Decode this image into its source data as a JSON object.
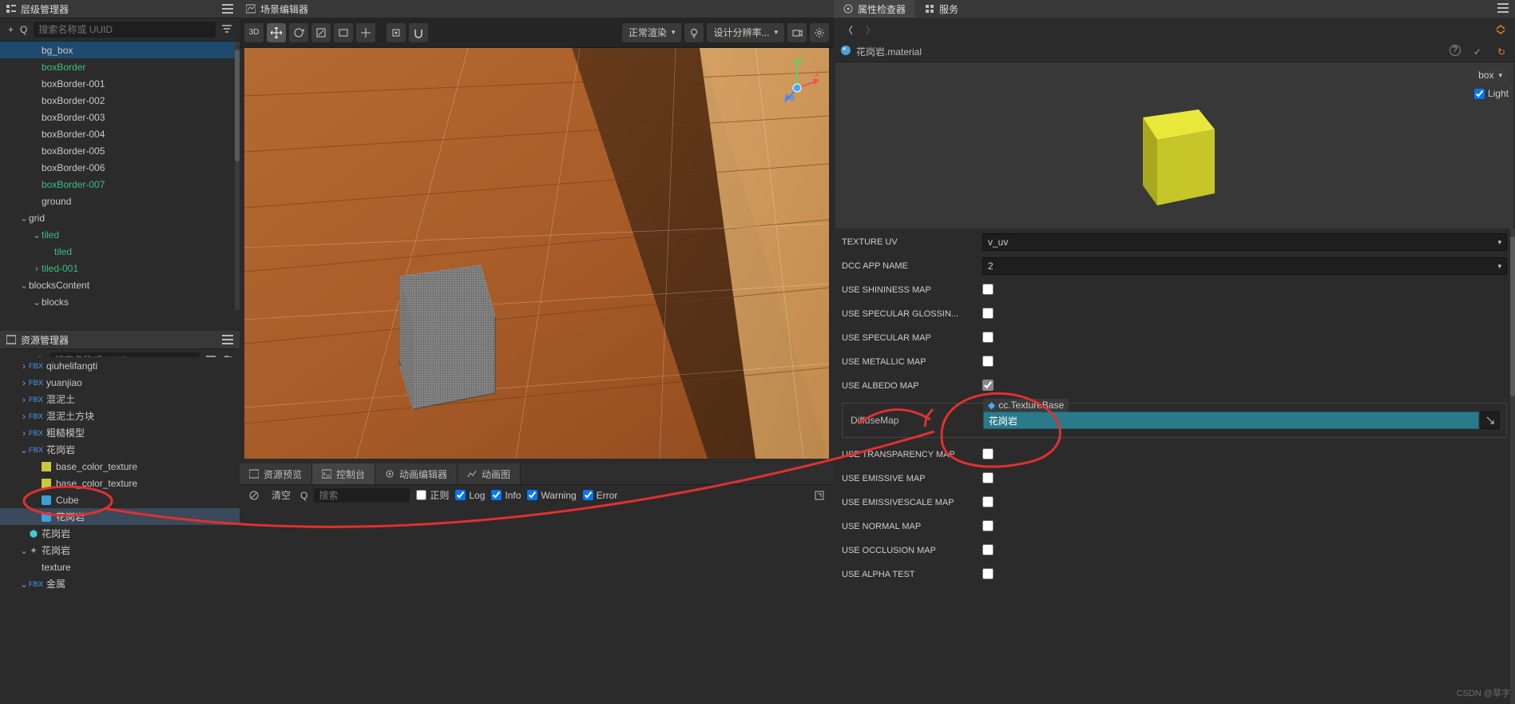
{
  "panels": {
    "hierarchy": {
      "title": "层级管理器",
      "search_placeholder": "搜索名称或 UUID"
    },
    "assets": {
      "title": "资源管理器",
      "search_placeholder": "搜索名称或 UUID"
    },
    "scene": {
      "title": "场景编辑器"
    },
    "inspector": {
      "title": "属性检查器"
    },
    "services": {
      "title": "服务"
    }
  },
  "hierarchy_tree": [
    {
      "label": "bg_box",
      "indent": 2,
      "sel": true
    },
    {
      "label": "boxBorder",
      "indent": 2,
      "green": true
    },
    {
      "label": "boxBorder-001",
      "indent": 2
    },
    {
      "label": "boxBorder-002",
      "indent": 2
    },
    {
      "label": "boxBorder-003",
      "indent": 2
    },
    {
      "label": "boxBorder-004",
      "indent": 2
    },
    {
      "label": "boxBorder-005",
      "indent": 2
    },
    {
      "label": "boxBorder-006",
      "indent": 2
    },
    {
      "label": "boxBorder-007",
      "indent": 2,
      "green": true
    },
    {
      "label": "ground",
      "indent": 2
    },
    {
      "label": "grid",
      "indent": 1,
      "arrow": "down"
    },
    {
      "label": "tiled",
      "indent": 2,
      "arrow": "down",
      "green": true
    },
    {
      "label": "tiled",
      "indent": 3,
      "green": true
    },
    {
      "label": "tiled-001",
      "indent": 2,
      "arrow": "right",
      "green": true
    },
    {
      "label": "blocksContent",
      "indent": 1,
      "arrow": "down"
    },
    {
      "label": "blocks",
      "indent": 2,
      "arrow": "down"
    }
  ],
  "asset_tree": [
    {
      "label": "qiuhelifangti",
      "indent": 1,
      "arrow": "right",
      "fbx": true
    },
    {
      "label": "yuanjiao",
      "indent": 1,
      "arrow": "right",
      "fbx": true
    },
    {
      "label": "混泥土",
      "indent": 1,
      "arrow": "right",
      "fbx": true
    },
    {
      "label": "混泥土方块",
      "indent": 1,
      "arrow": "right",
      "fbx": true
    },
    {
      "label": "粗糙模型",
      "indent": 1,
      "arrow": "right",
      "fbx": true
    },
    {
      "label": "花岗岩",
      "indent": 1,
      "arrow": "down",
      "fbx": true
    },
    {
      "label": "base_color_texture",
      "indent": 2,
      "icon": "yellow"
    },
    {
      "label": "base_color_texture",
      "indent": 2,
      "icon": "yellow"
    },
    {
      "label": "Cube",
      "indent": 2,
      "icon": "blue"
    },
    {
      "label": "花岗岩",
      "indent": 2,
      "icon": "blue",
      "hi": true
    },
    {
      "label": "花岗岩",
      "indent": 1,
      "arrow": "none",
      "icon": "teal"
    },
    {
      "label": "花岗岩",
      "indent": 1,
      "arrow": "down",
      "icon": "gray"
    },
    {
      "label": "texture",
      "indent": 2
    },
    {
      "label": "金属",
      "indent": 1,
      "arrow": "down",
      "fbx": true
    }
  ],
  "scene_toolbar": {
    "mode3d": "3D",
    "render_mode": "正常渲染",
    "resolution": "设计分辨率..."
  },
  "bottom_tabs": [
    "资源预览",
    "控制台",
    "动画编辑器",
    "动画图"
  ],
  "console": {
    "clear": "清空",
    "search": "搜索",
    "regex": "正则",
    "log": "Log",
    "info": "Info",
    "warning": "Warning",
    "error": "Error"
  },
  "inspector": {
    "material_name": "花岗岩.material",
    "preview_primitive": "box",
    "preview_light": "Light",
    "props": {
      "texture_uv": {
        "label": "TEXTURE UV",
        "value": "v_uv"
      },
      "dcc_app": {
        "label": "DCC APP NAME",
        "value": "2"
      },
      "use_shininess": {
        "label": "USE SHININESS MAP"
      },
      "use_spec_gloss": {
        "label": "USE SPECULAR GLOSSIN..."
      },
      "use_specular": {
        "label": "USE SPECULAR MAP"
      },
      "use_metallic": {
        "label": "USE METALLIC MAP"
      },
      "use_albedo": {
        "label": "USE ALBEDO MAP"
      },
      "diffuse_map": {
        "label": "DiffuseMap",
        "tag": "cc.TextureBase",
        "value": "花岗岩"
      },
      "use_transparency": {
        "label": "USE TRANSPARENCY MAP"
      },
      "use_emissive": {
        "label": "USE EMISSIVE MAP"
      },
      "use_emissivescale": {
        "label": "USE EMISSIVESCALE MAP"
      },
      "use_normal": {
        "label": "USE NORMAL MAP"
      },
      "use_occlusion": {
        "label": "USE OCCLUSION MAP"
      },
      "use_alpha_test": {
        "label": "USE ALPHA TEST"
      }
    }
  },
  "watermark": "CSDN @草字"
}
